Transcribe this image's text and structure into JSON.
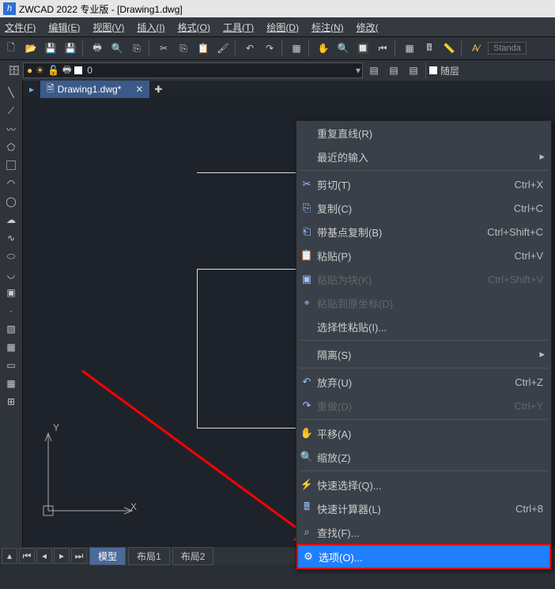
{
  "title": "ZWCAD 2022 专业版 - [Drawing1.dwg]",
  "menubar": [
    "文件(F)",
    "编辑(E)",
    "视图(V)",
    "插入(I)",
    "格式(O)",
    "工具(T)",
    "绘图(D)",
    "标注(N)",
    "修改("
  ],
  "styleBox": "Standa",
  "layerCombo": "0",
  "layerRight": "随层",
  "filetab": "Drawing1.dwg*",
  "layoutTabs": {
    "model": "模型",
    "l1": "布局1",
    "l2": "布局2"
  },
  "ucs": {
    "x": "X",
    "y": "Y"
  },
  "ctx": {
    "repeat": "重复直线(R)",
    "recent": "最近的输入",
    "cut": "剪切(T)",
    "cut_sc": "Ctrl+X",
    "copy": "复制(C)",
    "copy_sc": "Ctrl+C",
    "copybase": "带基点复制(B)",
    "copybase_sc": "Ctrl+Shift+C",
    "paste": "粘贴(P)",
    "paste_sc": "Ctrl+V",
    "pasteblock": "粘贴为块(K)",
    "pasteblock_sc": "Ctrl+Shift+V",
    "pasteorig": "粘贴到原坐标(D)",
    "pastespecial": "选择性粘贴(I)...",
    "isolate": "隔离(S)",
    "undo": "放弃(U)",
    "undo_sc": "Ctrl+Z",
    "redo": "重做(D)",
    "redo_sc": "Ctrl+Y",
    "pan": "平移(A)",
    "zoom": "缩放(Z)",
    "qselect": "快速选择(Q)...",
    "qcalc": "快速计算器(L)",
    "qcalc_sc": "Ctrl+8",
    "find": "查找(F)...",
    "options": "选项(O)..."
  }
}
